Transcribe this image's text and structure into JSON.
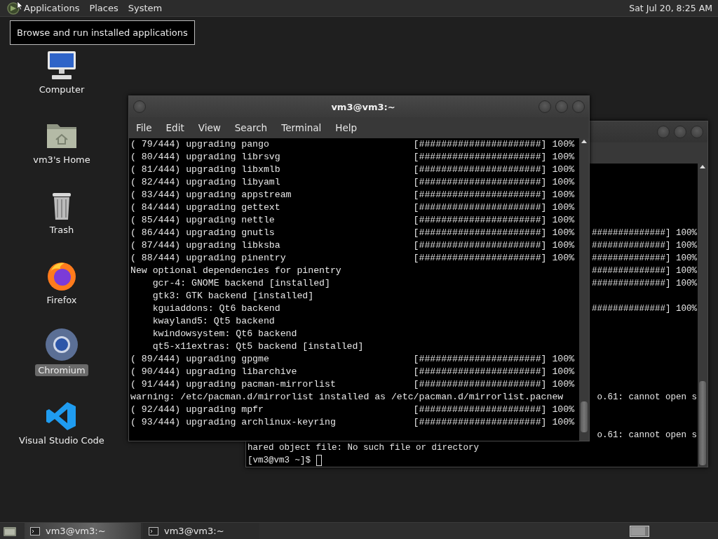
{
  "top_panel": {
    "menus": [
      {
        "label": "Applications"
      },
      {
        "label": "Places"
      },
      {
        "label": "System"
      }
    ],
    "clock": "Sat Jul 20, 8:25 AM"
  },
  "tooltip": "Browse and run installed applications",
  "desktop_icons": [
    {
      "label": "Computer",
      "kind": "computer",
      "selected": false
    },
    {
      "label": "vm3's Home",
      "kind": "home",
      "selected": false
    },
    {
      "label": "Trash",
      "kind": "trash",
      "selected": false
    },
    {
      "label": "Firefox",
      "kind": "firefox",
      "selected": false
    },
    {
      "label": "Chromium",
      "kind": "chromium",
      "selected": true
    },
    {
      "label": "Visual Studio Code",
      "kind": "vscode",
      "selected": false
    }
  ],
  "back_terminal": {
    "lines": [
      {
        "kind": "covered"
      },
      {
        "kind": "covered"
      },
      {
        "kind": "covered"
      },
      {
        "kind": "covered"
      },
      {
        "kind": "covered"
      },
      {
        "kind": "tail",
        "text": "##############] 100%"
      },
      {
        "kind": "tail",
        "text": "##############] 100%"
      },
      {
        "kind": "tail",
        "text": "##############] 100%"
      },
      {
        "kind": "tail",
        "text": "##############] 100%"
      },
      {
        "kind": "tail",
        "text": "##############] 100%"
      },
      {
        "kind": "covered"
      },
      {
        "kind": "tail",
        "text": "##############] 100%"
      },
      {
        "kind": "covered"
      },
      {
        "kind": "covered"
      },
      {
        "kind": "covered"
      },
      {
        "kind": "covered"
      },
      {
        "kind": "covered"
      },
      {
        "kind": "covered"
      },
      {
        "kind": "tail",
        "text": "o.61: cannot open s"
      },
      {
        "kind": "covered"
      },
      {
        "kind": "covered"
      },
      {
        "kind": "tail",
        "text": "o.61: cannot open s"
      },
      {
        "kind": "line",
        "text": "hared object file: No such file or directory"
      },
      {
        "kind": "prompt",
        "text": "[vm3@vm3 ~]$"
      }
    ]
  },
  "front_terminal": {
    "title": "vm3@vm3:~",
    "menu": [
      {
        "label": "File"
      },
      {
        "label": "Edit"
      },
      {
        "label": "View"
      },
      {
        "label": "Search"
      },
      {
        "label": "Terminal"
      },
      {
        "label": "Help"
      }
    ],
    "lines": [
      {
        "kind": "progress",
        "text": "( 79/444) upgrading pango",
        "bar": "[######################] 100%"
      },
      {
        "kind": "progress",
        "text": "( 80/444) upgrading librsvg",
        "bar": "[######################] 100%"
      },
      {
        "kind": "progress",
        "text": "( 81/444) upgrading libxmlb",
        "bar": "[######################] 100%"
      },
      {
        "kind": "progress",
        "text": "( 82/444) upgrading libyaml",
        "bar": "[######################] 100%"
      },
      {
        "kind": "progress",
        "text": "( 83/444) upgrading appstream",
        "bar": "[######################] 100%"
      },
      {
        "kind": "progress",
        "text": "( 84/444) upgrading gettext",
        "bar": "[######################] 100%"
      },
      {
        "kind": "progress",
        "text": "( 85/444) upgrading nettle",
        "bar": "[######################] 100%"
      },
      {
        "kind": "progress",
        "text": "( 86/444) upgrading gnutls",
        "bar": "[######################] 100%"
      },
      {
        "kind": "progress",
        "text": "( 87/444) upgrading libksba",
        "bar": "[######################] 100%"
      },
      {
        "kind": "progress",
        "text": "( 88/444) upgrading pinentry",
        "bar": "[######################] 100%"
      },
      {
        "kind": "group",
        "text": "New optional dependencies for pinentry",
        "children": [
          {
            "text": "gcr-4: GNOME backend [installed]"
          },
          {
            "text": "gtk3: GTK backend [installed]"
          },
          {
            "text": "kguiaddons: Qt6 backend"
          },
          {
            "text": "kwayland5: Qt5 backend"
          },
          {
            "text": "kwindowsystem: Qt6 backend"
          },
          {
            "text": "qt5-x11extras: Qt5 backend [installed]"
          }
        ]
      },
      {
        "kind": "progress",
        "text": "( 89/444) upgrading gpgme",
        "bar": "[######################] 100%"
      },
      {
        "kind": "progress",
        "text": "( 90/444) upgrading libarchive",
        "bar": "[######################] 100%"
      },
      {
        "kind": "progress",
        "text": "( 91/444) upgrading pacman-mirrorlist",
        "bar": "[######################] 100%"
      },
      {
        "kind": "plain",
        "text": "warning: /etc/pacman.d/mirrorlist installed as /etc/pacman.d/mirrorlist.pacnew"
      },
      {
        "kind": "progress",
        "text": "( 92/444) upgrading mpfr",
        "bar": "[######################] 100%"
      },
      {
        "kind": "progress",
        "text": "( 93/444) upgrading archlinux-keyring",
        "bar": "[######################] 100%"
      }
    ]
  },
  "taskbar": {
    "tasks": [
      {
        "label": "vm3@vm3:~",
        "selected": true
      },
      {
        "label": "vm3@vm3:~",
        "selected": false
      }
    ]
  }
}
